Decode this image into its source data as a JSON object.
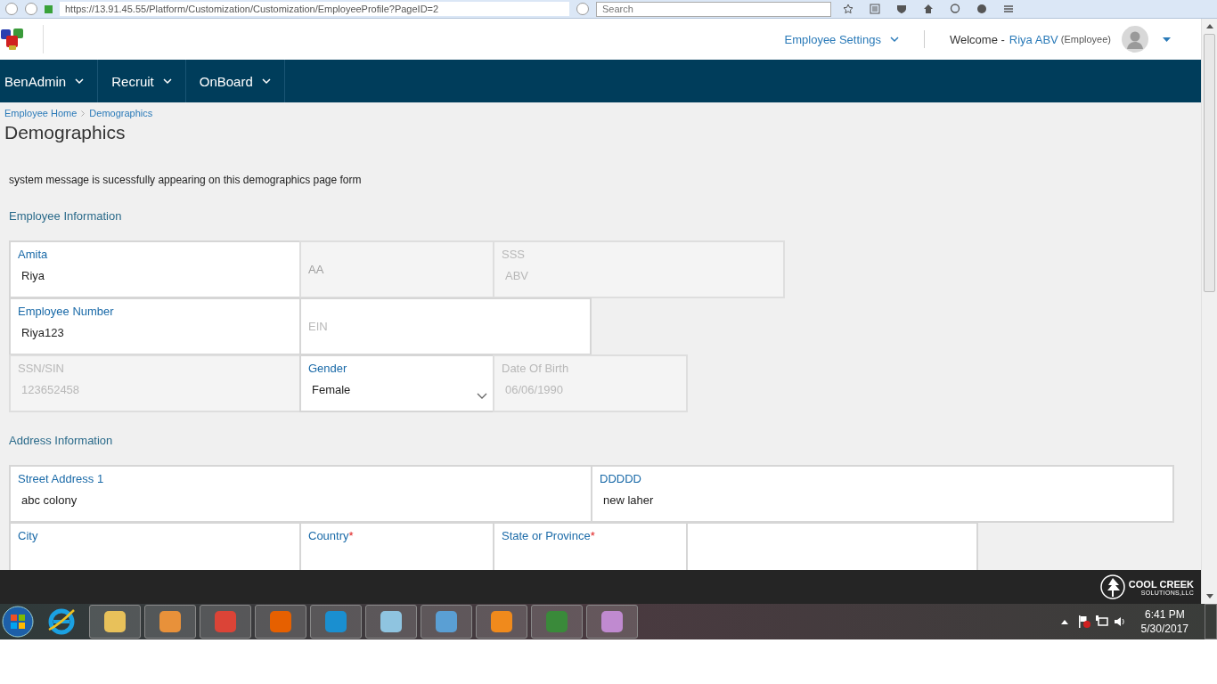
{
  "browser": {
    "url": "https://13.91.45.55/Platform/Customization/Customization/EmployeeProfile?PageID=2",
    "search_placeholder": "Search"
  },
  "header": {
    "settings": "Employee Settings",
    "welcome": "Welcome -",
    "user": "Riya ABV",
    "role": "(Employee)"
  },
  "nav": [
    {
      "label": "BenAdmin"
    },
    {
      "label": "Recruit"
    },
    {
      "label": "OnBoard"
    }
  ],
  "breadcrumb": [
    "Employee Home",
    "Demographics"
  ],
  "title": "Demographics",
  "message": "system message is sucessfully appearing on this demographics page form",
  "sections": [
    {
      "title": "Employee Information",
      "rows": [
        [
          {
            "kind": "text",
            "label": "Amita",
            "value": "Riya",
            "disabled": false
          },
          {
            "kind": "text",
            "placeholder": "AA",
            "disabled": true
          },
          {
            "kind": "text",
            "label": "SSS",
            "value": "ABV",
            "disabled": true
          }
        ],
        [
          {
            "kind": "text",
            "label": "Employee Number",
            "value": "Riya123",
            "disabled": false
          },
          {
            "kind": "text",
            "placeholder": "EIN",
            "disabled": false
          }
        ],
        [
          {
            "kind": "text",
            "label": "SSN/SIN",
            "value": "123652458",
            "disabled": true
          },
          {
            "kind": "select",
            "label": "Gender",
            "value": "Female",
            "disabled": false
          },
          {
            "kind": "text",
            "label": "Date Of Birth",
            "value": "06/06/1990",
            "disabled": true
          }
        ]
      ]
    },
    {
      "title": "Address Information",
      "rows": [
        [
          {
            "kind": "text",
            "label": "Street Address 1",
            "value": "abc colony",
            "disabled": false
          },
          {
            "kind": "text",
            "label": "DDDDD",
            "value": "new laher",
            "disabled": false
          }
        ],
        [
          {
            "kind": "text",
            "label": "City",
            "disabled": false
          },
          {
            "kind": "text",
            "label": "Country",
            "mark": "*",
            "disabled": false
          },
          {
            "kind": "text",
            "label": "State or Province",
            "mark": "*",
            "disabled": false
          },
          {
            "kind": "blank"
          }
        ]
      ]
    }
  ],
  "footer": {
    "logo_name": "COOL CREEK",
    "logo_sub": "SOLUTIONS,LLC"
  },
  "taskbar": {
    "time": "6:41 PM",
    "date": "5/30/2017"
  }
}
